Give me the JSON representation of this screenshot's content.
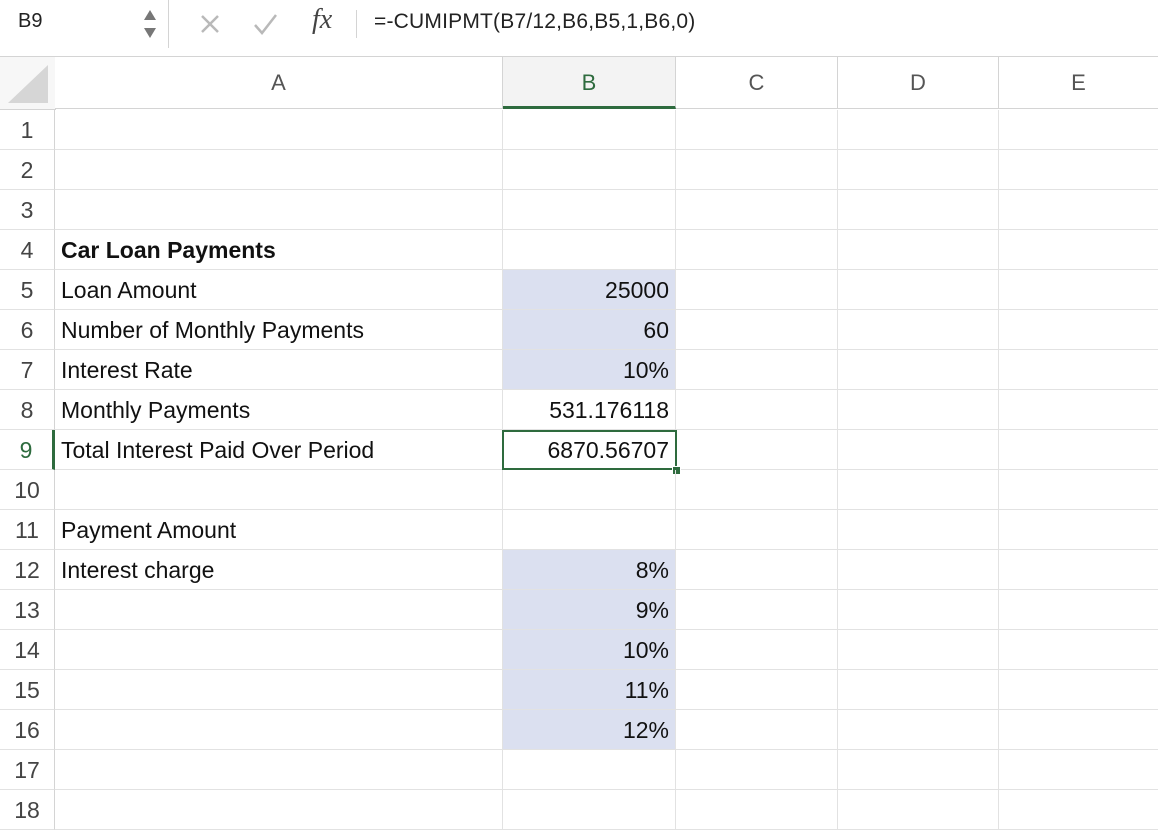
{
  "formula_bar": {
    "name_box": "B9",
    "fx_label": "fx",
    "formula": "=-CUMIPMT(B7/12,B6,B5,1,B6,0)",
    "icons": [
      "cancel-icon",
      "confirm-icon",
      "function-icon",
      "stepper-icon"
    ]
  },
  "columns": [
    "A",
    "B",
    "C",
    "D",
    "E"
  ],
  "selected_column": "B",
  "selected_row": "9",
  "rows": [
    {
      "num": "1",
      "a": "",
      "b": ""
    },
    {
      "num": "2",
      "a": "",
      "b": ""
    },
    {
      "num": "3",
      "a": "",
      "b": ""
    },
    {
      "num": "4",
      "a": "Car Loan Payments",
      "b": ""
    },
    {
      "num": "5",
      "a": "Loan Amount",
      "b": "25000"
    },
    {
      "num": "6",
      "a": "Number of Monthly Payments",
      "b": "60"
    },
    {
      "num": "7",
      "a": "Interest Rate",
      "b": "10%"
    },
    {
      "num": "8",
      "a": "Monthly Payments",
      "b": "531.176118"
    },
    {
      "num": "9",
      "a": "Total Interest Paid Over Period",
      "b": "6870.56707"
    },
    {
      "num": "10",
      "a": "",
      "b": ""
    },
    {
      "num": "11",
      "a": "Payment Amount",
      "b": ""
    },
    {
      "num": "12",
      "a": "Interest charge",
      "b": "8%"
    },
    {
      "num": "13",
      "a": "",
      "b": "9%"
    },
    {
      "num": "14",
      "a": "",
      "b": "10%"
    },
    {
      "num": "15",
      "a": "",
      "b": "11%"
    },
    {
      "num": "16",
      "a": "",
      "b": "12%"
    },
    {
      "num": "17",
      "a": "",
      "b": ""
    },
    {
      "num": "18",
      "a": "",
      "b": ""
    }
  ],
  "colors": {
    "accent": "#2e6b3e",
    "input_fill": "#dbe0f0",
    "gridline": "#e2e2e2"
  }
}
